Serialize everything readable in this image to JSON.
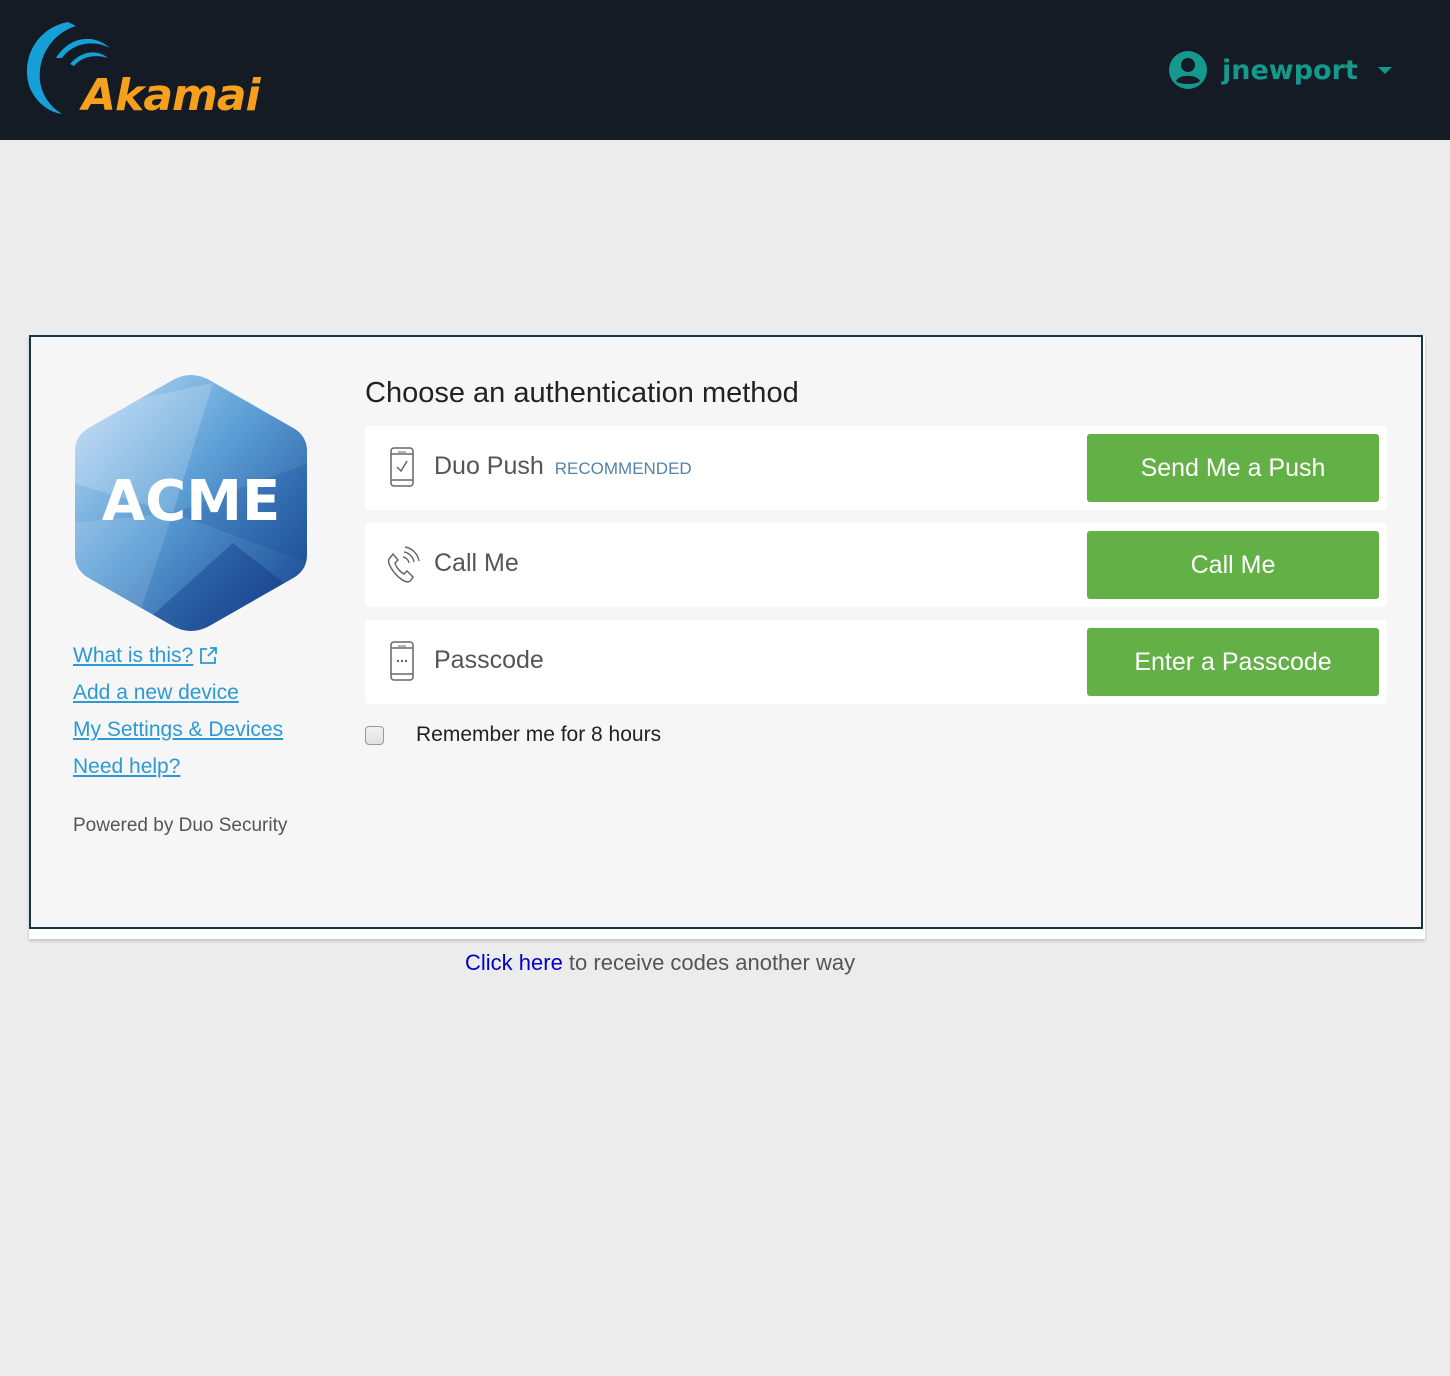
{
  "header": {
    "brand": "Akamai",
    "user": {
      "name": "jnewport",
      "icon": "user-circle-icon",
      "menu_icon": "caret-down-icon"
    },
    "colors": {
      "background": "#141b24",
      "brand_orange": "#f7a01d",
      "brand_blue": "#16a0d8",
      "user_teal": "#14998c"
    }
  },
  "sidebar": {
    "logo_text": "ACME",
    "links": [
      {
        "label": "What is this?",
        "icon": "external-link-icon"
      },
      {
        "label": "Add a new device"
      },
      {
        "label": "My Settings & Devices"
      },
      {
        "label": "Need help?"
      }
    ],
    "powered_by": "Powered by Duo Security"
  },
  "main": {
    "title": "Choose an authentication method",
    "methods": [
      {
        "label": "Duo Push",
        "badge": "RECOMMENDED",
        "icon": "phone-check-icon",
        "button": "Send Me a Push"
      },
      {
        "label": "Call Me",
        "badge": "",
        "icon": "phone-call-icon",
        "button": "Call Me"
      },
      {
        "label": "Passcode",
        "badge": "",
        "icon": "phone-passcode-icon",
        "button": "Enter a Passcode"
      }
    ],
    "remember": {
      "label": "Remember me for 8 hours",
      "checked": false
    },
    "accent_color": "#63b146"
  },
  "footer": {
    "link": "Click here",
    "text": " to receive codes another way"
  }
}
